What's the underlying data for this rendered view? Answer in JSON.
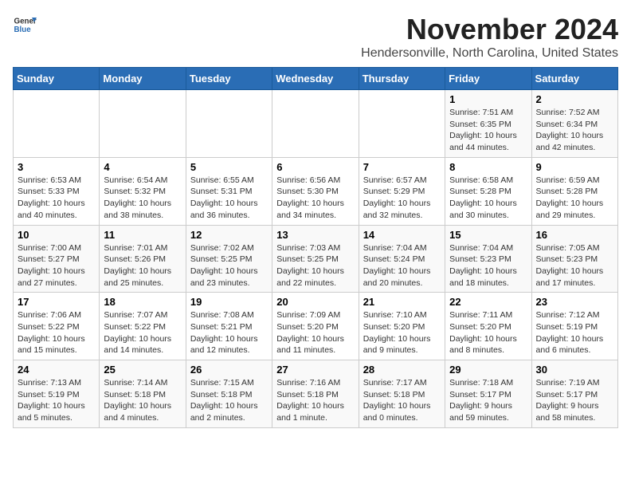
{
  "logo": {
    "text_general": "General",
    "text_blue": "Blue"
  },
  "title": {
    "month": "November 2024",
    "location": "Hendersonville, North Carolina, United States"
  },
  "weekdays": [
    "Sunday",
    "Monday",
    "Tuesday",
    "Wednesday",
    "Thursday",
    "Friday",
    "Saturday"
  ],
  "weeks": [
    [
      null,
      null,
      null,
      null,
      null,
      {
        "day": "1",
        "sunrise": "Sunrise: 7:51 AM",
        "sunset": "Sunset: 6:35 PM",
        "daylight": "Daylight: 10 hours and 44 minutes."
      },
      {
        "day": "2",
        "sunrise": "Sunrise: 7:52 AM",
        "sunset": "Sunset: 6:34 PM",
        "daylight": "Daylight: 10 hours and 42 minutes."
      }
    ],
    [
      {
        "day": "3",
        "sunrise": "Sunrise: 6:53 AM",
        "sunset": "Sunset: 5:33 PM",
        "daylight": "Daylight: 10 hours and 40 minutes."
      },
      {
        "day": "4",
        "sunrise": "Sunrise: 6:54 AM",
        "sunset": "Sunset: 5:32 PM",
        "daylight": "Daylight: 10 hours and 38 minutes."
      },
      {
        "day": "5",
        "sunrise": "Sunrise: 6:55 AM",
        "sunset": "Sunset: 5:31 PM",
        "daylight": "Daylight: 10 hours and 36 minutes."
      },
      {
        "day": "6",
        "sunrise": "Sunrise: 6:56 AM",
        "sunset": "Sunset: 5:30 PM",
        "daylight": "Daylight: 10 hours and 34 minutes."
      },
      {
        "day": "7",
        "sunrise": "Sunrise: 6:57 AM",
        "sunset": "Sunset: 5:29 PM",
        "daylight": "Daylight: 10 hours and 32 minutes."
      },
      {
        "day": "8",
        "sunrise": "Sunrise: 6:58 AM",
        "sunset": "Sunset: 5:28 PM",
        "daylight": "Daylight: 10 hours and 30 minutes."
      },
      {
        "day": "9",
        "sunrise": "Sunrise: 6:59 AM",
        "sunset": "Sunset: 5:28 PM",
        "daylight": "Daylight: 10 hours and 29 minutes."
      }
    ],
    [
      {
        "day": "10",
        "sunrise": "Sunrise: 7:00 AM",
        "sunset": "Sunset: 5:27 PM",
        "daylight": "Daylight: 10 hours and 27 minutes."
      },
      {
        "day": "11",
        "sunrise": "Sunrise: 7:01 AM",
        "sunset": "Sunset: 5:26 PM",
        "daylight": "Daylight: 10 hours and 25 minutes."
      },
      {
        "day": "12",
        "sunrise": "Sunrise: 7:02 AM",
        "sunset": "Sunset: 5:25 PM",
        "daylight": "Daylight: 10 hours and 23 minutes."
      },
      {
        "day": "13",
        "sunrise": "Sunrise: 7:03 AM",
        "sunset": "Sunset: 5:25 PM",
        "daylight": "Daylight: 10 hours and 22 minutes."
      },
      {
        "day": "14",
        "sunrise": "Sunrise: 7:04 AM",
        "sunset": "Sunset: 5:24 PM",
        "daylight": "Daylight: 10 hours and 20 minutes."
      },
      {
        "day": "15",
        "sunrise": "Sunrise: 7:04 AM",
        "sunset": "Sunset: 5:23 PM",
        "daylight": "Daylight: 10 hours and 18 minutes."
      },
      {
        "day": "16",
        "sunrise": "Sunrise: 7:05 AM",
        "sunset": "Sunset: 5:23 PM",
        "daylight": "Daylight: 10 hours and 17 minutes."
      }
    ],
    [
      {
        "day": "17",
        "sunrise": "Sunrise: 7:06 AM",
        "sunset": "Sunset: 5:22 PM",
        "daylight": "Daylight: 10 hours and 15 minutes."
      },
      {
        "day": "18",
        "sunrise": "Sunrise: 7:07 AM",
        "sunset": "Sunset: 5:22 PM",
        "daylight": "Daylight: 10 hours and 14 minutes."
      },
      {
        "day": "19",
        "sunrise": "Sunrise: 7:08 AM",
        "sunset": "Sunset: 5:21 PM",
        "daylight": "Daylight: 10 hours and 12 minutes."
      },
      {
        "day": "20",
        "sunrise": "Sunrise: 7:09 AM",
        "sunset": "Sunset: 5:20 PM",
        "daylight": "Daylight: 10 hours and 11 minutes."
      },
      {
        "day": "21",
        "sunrise": "Sunrise: 7:10 AM",
        "sunset": "Sunset: 5:20 PM",
        "daylight": "Daylight: 10 hours and 9 minutes."
      },
      {
        "day": "22",
        "sunrise": "Sunrise: 7:11 AM",
        "sunset": "Sunset: 5:20 PM",
        "daylight": "Daylight: 10 hours and 8 minutes."
      },
      {
        "day": "23",
        "sunrise": "Sunrise: 7:12 AM",
        "sunset": "Sunset: 5:19 PM",
        "daylight": "Daylight: 10 hours and 6 minutes."
      }
    ],
    [
      {
        "day": "24",
        "sunrise": "Sunrise: 7:13 AM",
        "sunset": "Sunset: 5:19 PM",
        "daylight": "Daylight: 10 hours and 5 minutes."
      },
      {
        "day": "25",
        "sunrise": "Sunrise: 7:14 AM",
        "sunset": "Sunset: 5:18 PM",
        "daylight": "Daylight: 10 hours and 4 minutes."
      },
      {
        "day": "26",
        "sunrise": "Sunrise: 7:15 AM",
        "sunset": "Sunset: 5:18 PM",
        "daylight": "Daylight: 10 hours and 2 minutes."
      },
      {
        "day": "27",
        "sunrise": "Sunrise: 7:16 AM",
        "sunset": "Sunset: 5:18 PM",
        "daylight": "Daylight: 10 hours and 1 minute."
      },
      {
        "day": "28",
        "sunrise": "Sunrise: 7:17 AM",
        "sunset": "Sunset: 5:18 PM",
        "daylight": "Daylight: 10 hours and 0 minutes."
      },
      {
        "day": "29",
        "sunrise": "Sunrise: 7:18 AM",
        "sunset": "Sunset: 5:17 PM",
        "daylight": "Daylight: 9 hours and 59 minutes."
      },
      {
        "day": "30",
        "sunrise": "Sunrise: 7:19 AM",
        "sunset": "Sunset: 5:17 PM",
        "daylight": "Daylight: 9 hours and 58 minutes."
      }
    ]
  ]
}
